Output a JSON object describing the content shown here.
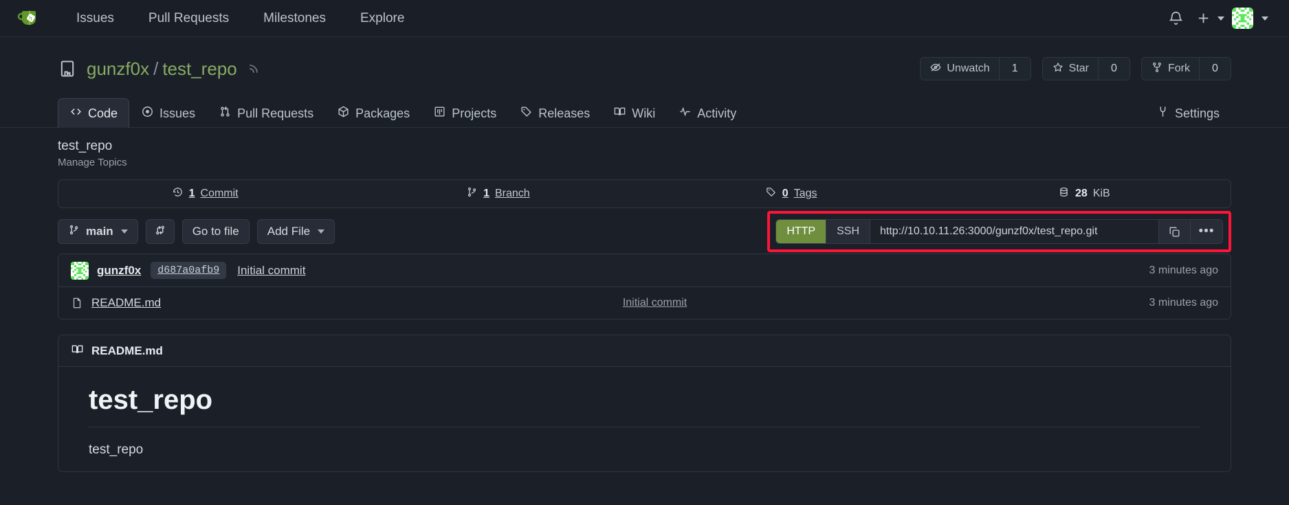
{
  "navbar": {
    "logo_icon": "gitea-logo-icon",
    "links": [
      {
        "label": "Issues",
        "name": "nav-link-issues"
      },
      {
        "label": "Pull Requests",
        "name": "nav-link-pull-requests"
      },
      {
        "label": "Milestones",
        "name": "nav-link-milestones"
      },
      {
        "label": "Explore",
        "name": "nav-link-explore"
      }
    ],
    "notification_icon": "bell-icon",
    "create_icon": "plus-icon",
    "avatar_icon": "user-avatar-identicon"
  },
  "repo": {
    "owner": "gunzf0x",
    "separator": "/",
    "name": "test_repo",
    "rss_icon": "rss-icon",
    "repo_icon": "repo-book-icon",
    "watch": {
      "label": "Unwatch",
      "count": "1",
      "icon": "eye-slash-icon"
    },
    "star": {
      "label": "Star",
      "count": "0",
      "icon": "star-icon"
    },
    "fork": {
      "label": "Fork",
      "count": "0",
      "icon": "fork-icon"
    }
  },
  "tabs": [
    {
      "label": "Code",
      "icon": "code-icon",
      "active": true
    },
    {
      "label": "Issues",
      "icon": "issue-opened-icon",
      "active": false
    },
    {
      "label": "Pull Requests",
      "icon": "git-pull-request-icon",
      "active": false
    },
    {
      "label": "Packages",
      "icon": "package-icon",
      "active": false
    },
    {
      "label": "Projects",
      "icon": "project-icon",
      "active": false
    },
    {
      "label": "Releases",
      "icon": "tag-icon",
      "active": false
    },
    {
      "label": "Wiki",
      "icon": "book-icon",
      "active": false
    },
    {
      "label": "Activity",
      "icon": "pulse-icon",
      "active": false
    }
  ],
  "settings_tab": {
    "label": "Settings",
    "icon": "tools-icon"
  },
  "overview": {
    "title": "test_repo",
    "manage_topics": "Manage Topics"
  },
  "stats": [
    {
      "icon": "history-icon",
      "value": "1",
      "label": "Commit"
    },
    {
      "icon": "git-branch-icon",
      "value": "1",
      "label": "Branch"
    },
    {
      "icon": "tag-icon",
      "value": "0",
      "label": "Tags"
    },
    {
      "icon": "database-icon",
      "value": "28",
      "label": "KiB"
    }
  ],
  "toolbar": {
    "branch_label": "main",
    "branch_icon": "git-branch-icon",
    "compare_icon": "git-compare-icon",
    "go_to_file_label": "Go to file",
    "add_file_label": "Add File"
  },
  "clone": {
    "http_label": "HTTP",
    "ssh_label": "SSH",
    "active_protocol": "HTTP",
    "url": "http://10.10.11.26:3000/gunzf0x/test_repo.git",
    "copy_icon": "copy-icon",
    "more_label": "•••",
    "highlight_color": "#ff1438",
    "active_color": "#6f8f3f"
  },
  "latest_commit": {
    "author": "gunzf0x",
    "sha": "d687a0afb9",
    "message": "Initial commit",
    "time": "3 minutes ago",
    "avatar_icon": "user-avatar-identicon"
  },
  "files": [
    {
      "icon": "file-icon",
      "name": "README.md",
      "commit_message": "Initial commit",
      "time": "3 minutes ago"
    }
  ],
  "readme": {
    "header_icon": "book-icon",
    "header_label": "README.md",
    "heading": "test_repo",
    "paragraph": "test_repo"
  }
}
